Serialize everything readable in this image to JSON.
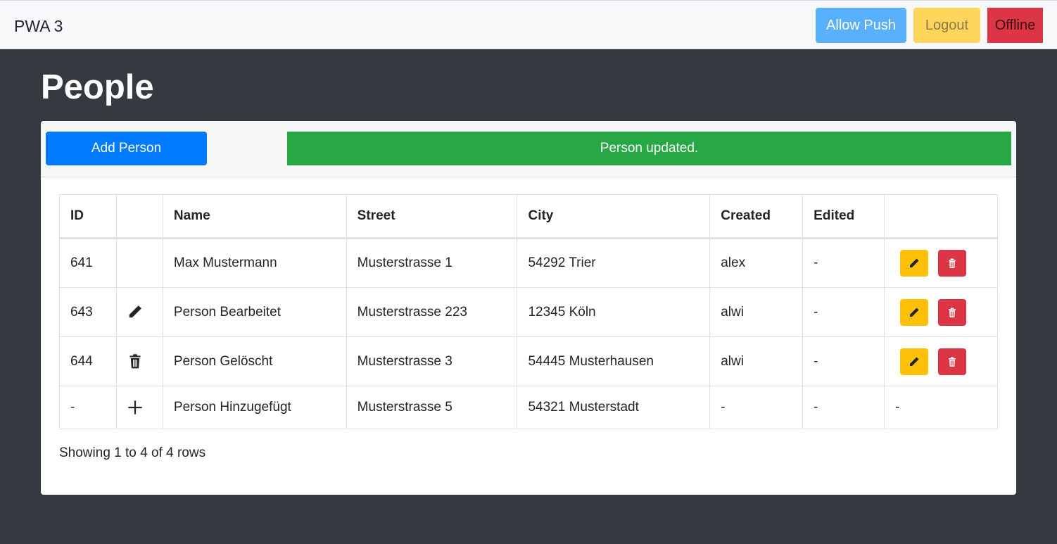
{
  "navbar": {
    "brand": "PWA 3",
    "allow_push_label": "Allow Push",
    "logout_label": "Logout",
    "offline_label": "Offline"
  },
  "page": {
    "title": "People"
  },
  "toolbar": {
    "add_person_label": "Add Person",
    "status_message": "Person updated."
  },
  "table": {
    "headers": [
      "ID",
      "",
      "Name",
      "Street",
      "City",
      "Created",
      "Edited",
      ""
    ],
    "rows": [
      {
        "id": "641",
        "icon": "",
        "name": "Max Mustermann",
        "street": "Musterstrasse 1",
        "city": "54292 Trier",
        "created": "alex",
        "edited": "-",
        "actions": "edit-delete"
      },
      {
        "id": "643",
        "icon": "pencil-icon",
        "name": "Person Bearbeitet",
        "street": "Musterstrasse 223",
        "city": "12345 Köln",
        "created": "alwi",
        "edited": "-",
        "actions": "edit-delete"
      },
      {
        "id": "644",
        "icon": "trash-icon",
        "name": "Person Gelöscht",
        "street": "Musterstrasse 3",
        "city": "54445 Musterhausen",
        "created": "alwi",
        "edited": "-",
        "actions": "edit-delete"
      },
      {
        "id": "-",
        "icon": "plus-icon",
        "name": "Person Hinzugefügt",
        "street": "Musterstrasse 5",
        "city": "54321 Musterstadt",
        "created": "-",
        "edited": "-",
        "actions": "-"
      }
    ]
  },
  "pagination": {
    "summary": "Showing 1 to 4 of 4 rows"
  },
  "colors": {
    "primary": "#007bff",
    "success": "#28a745",
    "warning": "#ffc107",
    "danger": "#dc3545",
    "dark_bg": "#343a40"
  }
}
